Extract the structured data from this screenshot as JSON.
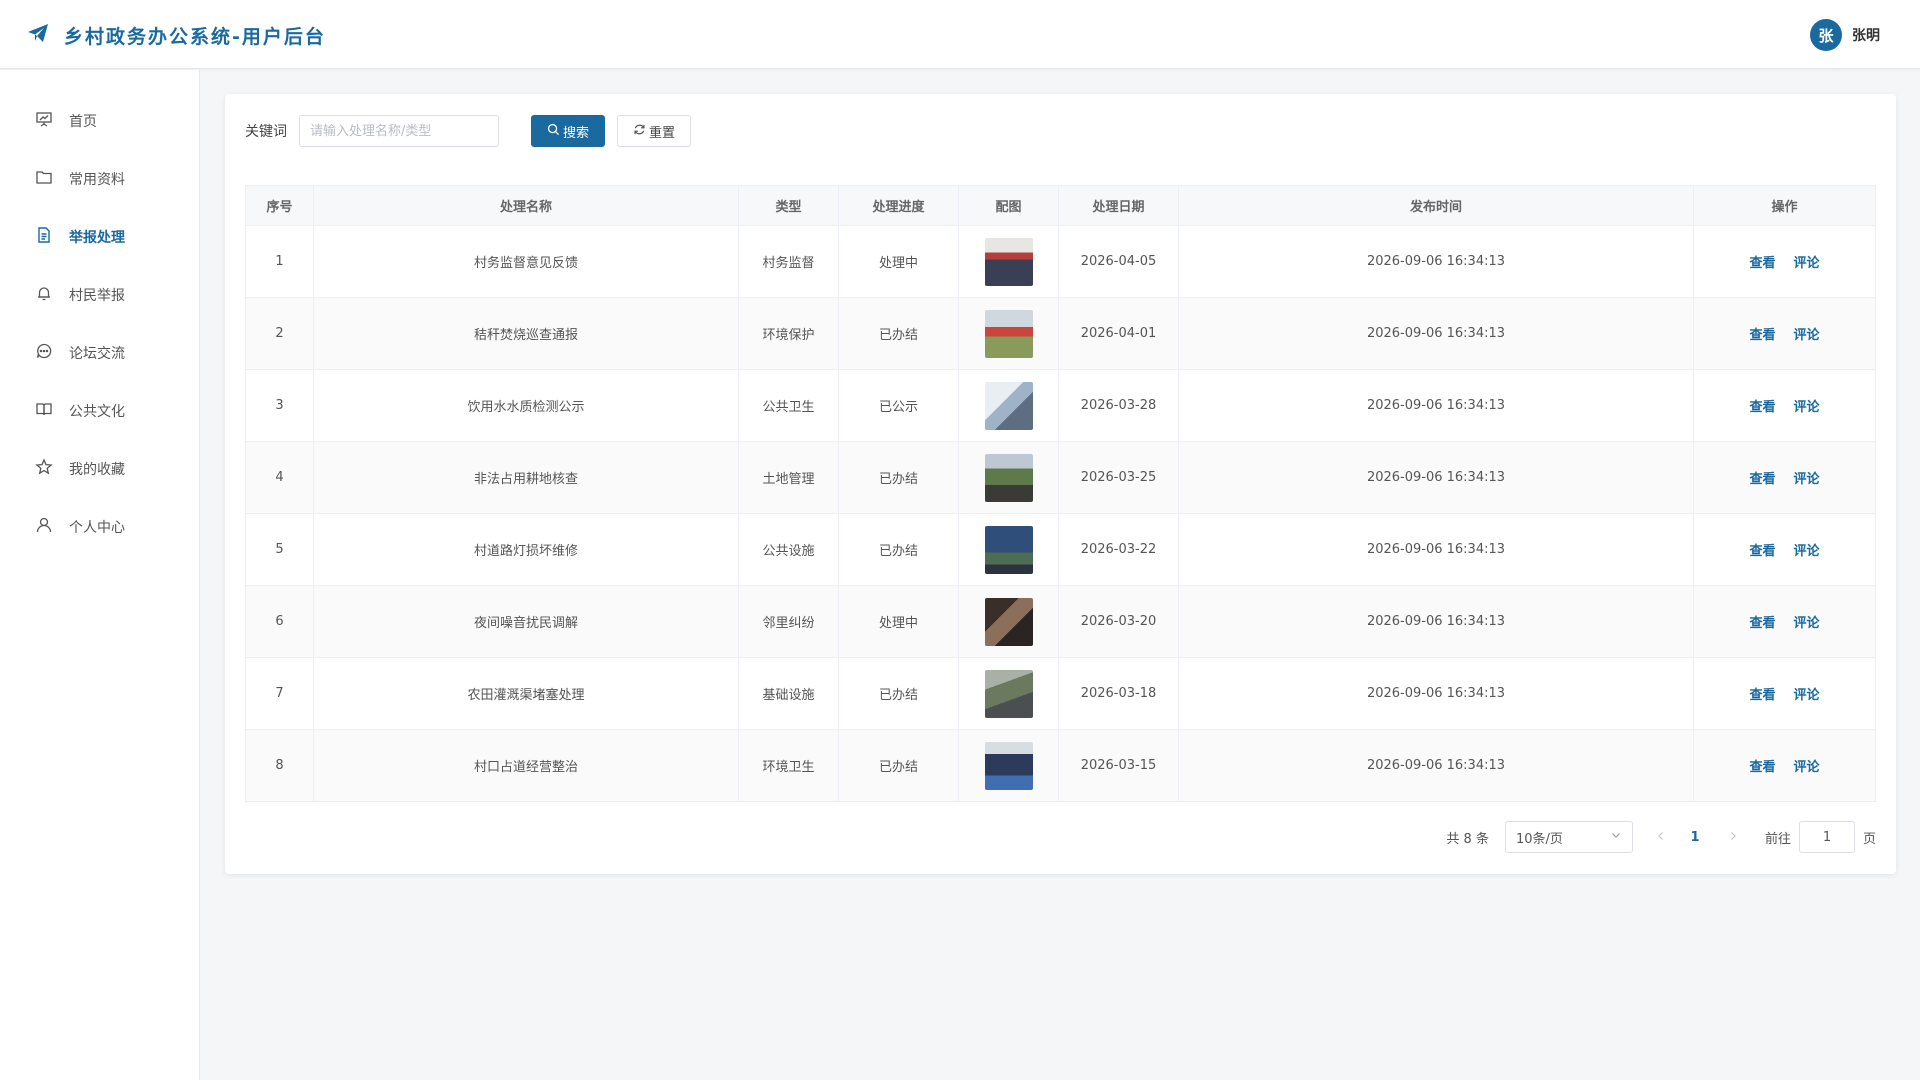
{
  "header": {
    "title": "乡村政务办公系统-用户后台",
    "logo_icon": "paper-plane-icon",
    "user_avatar_char": "张",
    "user_name": "张明",
    "accent_color": "#1a6aa0"
  },
  "sidebar": {
    "items": [
      {
        "label": "首页",
        "icon": "presentation-icon",
        "active": false
      },
      {
        "label": "常用资料",
        "icon": "folder-icon",
        "active": false
      },
      {
        "label": "举报处理",
        "icon": "document-icon",
        "active": true
      },
      {
        "label": "村民举报",
        "icon": "bell-icon",
        "active": false
      },
      {
        "label": "论坛交流",
        "icon": "chat-icon",
        "active": false
      },
      {
        "label": "公共文化",
        "icon": "book-icon",
        "active": false
      },
      {
        "label": "我的收藏",
        "icon": "star-icon",
        "active": false
      },
      {
        "label": "个人中心",
        "icon": "user-icon",
        "active": false
      }
    ]
  },
  "filter": {
    "keyword_label": "关键词",
    "keyword_placeholder": "请输入处理名称/类型",
    "keyword_value": "",
    "search_label": "搜索",
    "reset_label": "重置"
  },
  "table": {
    "columns": [
      "序号",
      "处理名称",
      "类型",
      "处理进度",
      "配图",
      "处理日期",
      "发布时间",
      "操作"
    ],
    "view_label": "查看",
    "comment_label": "评论",
    "rows": [
      {
        "index": "1",
        "name": "村务监督意见反馈",
        "type": "村务监督",
        "status": "处理中",
        "date": "2026-04-05",
        "published": "2026-09-06 16:34:13"
      },
      {
        "index": "2",
        "name": "秸秆焚烧巡查通报",
        "type": "环境保护",
        "status": "已办结",
        "date": "2026-04-01",
        "published": "2026-09-06 16:34:13"
      },
      {
        "index": "3",
        "name": "饮用水水质检测公示",
        "type": "公共卫生",
        "status": "已公示",
        "date": "2026-03-28",
        "published": "2026-09-06 16:34:13"
      },
      {
        "index": "4",
        "name": "非法占用耕地核查",
        "type": "土地管理",
        "status": "已办结",
        "date": "2026-03-25",
        "published": "2026-09-06 16:34:13"
      },
      {
        "index": "5",
        "name": "村道路灯损坏维修",
        "type": "公共设施",
        "status": "已办结",
        "date": "2026-03-22",
        "published": "2026-09-06 16:34:13"
      },
      {
        "index": "6",
        "name": "夜间噪音扰民调解",
        "type": "邻里纠纷",
        "status": "处理中",
        "date": "2026-03-20",
        "published": "2026-09-06 16:34:13"
      },
      {
        "index": "7",
        "name": "农田灌溉渠堵塞处理",
        "type": "基础设施",
        "status": "已办结",
        "date": "2026-03-18",
        "published": "2026-09-06 16:34:13"
      },
      {
        "index": "8",
        "name": "村口占道经营整治",
        "type": "环境卫生",
        "status": "已办结",
        "date": "2026-03-15",
        "published": "2026-09-06 16:34:13"
      }
    ]
  },
  "pagination": {
    "total_text": "共 8 条",
    "page_size": "10条/页",
    "current_page": "1",
    "goto_label": "前往",
    "goto_value": "1",
    "page_unit": "页"
  }
}
